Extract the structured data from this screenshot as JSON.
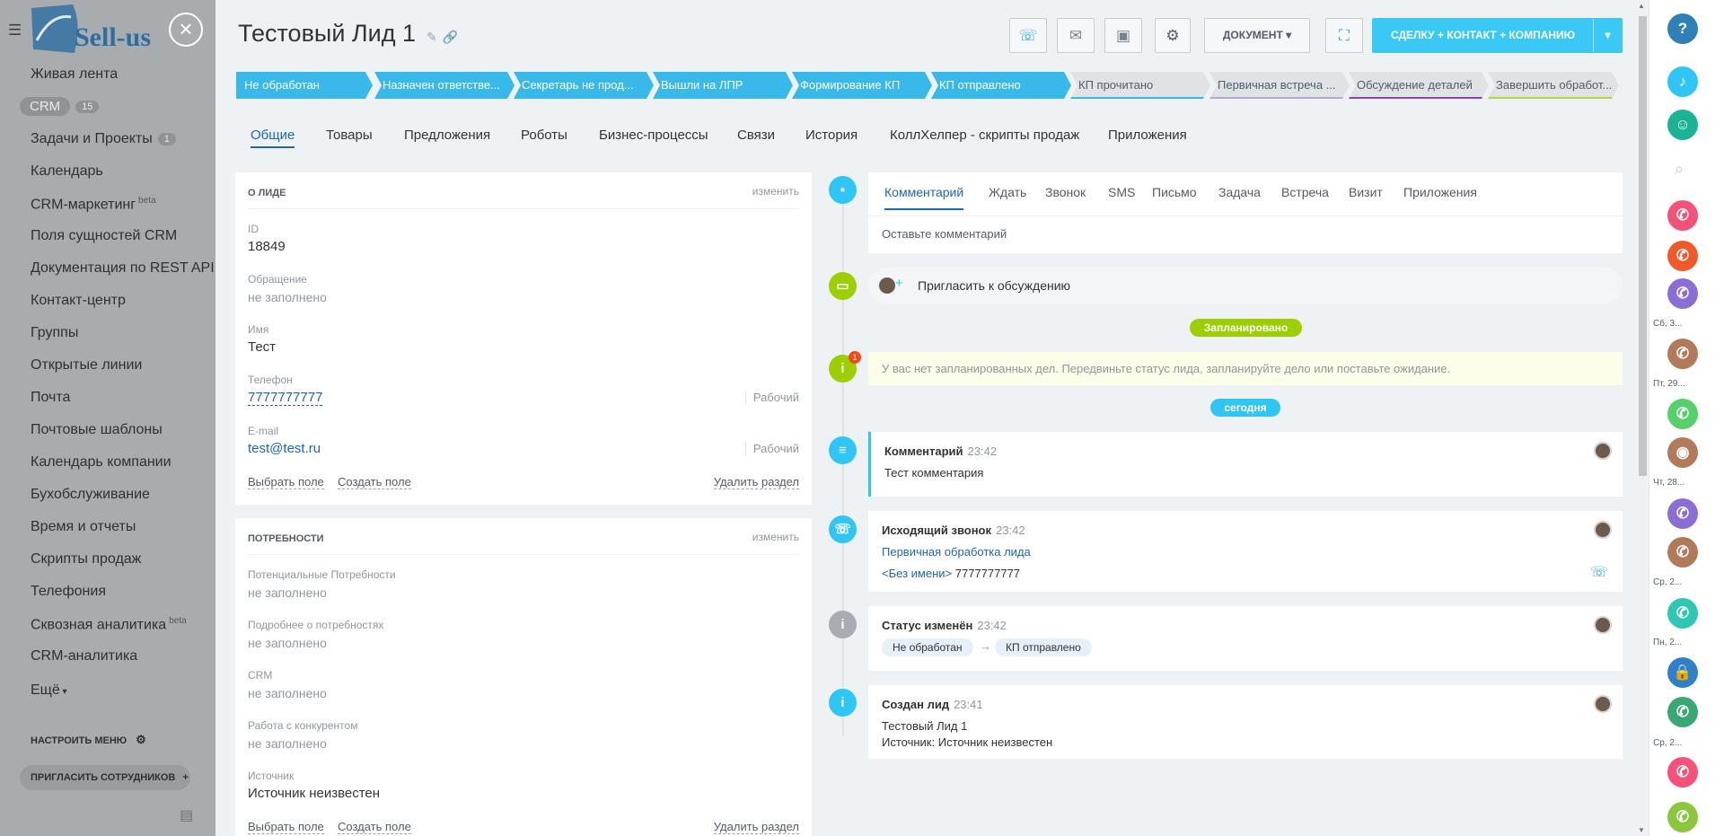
{
  "left_menu": {
    "logo_text": "Sell-us",
    "items": [
      {
        "label": "Живая лента"
      },
      {
        "label": "CRM",
        "badge": "15"
      },
      {
        "label": "Задачи и Проекты",
        "badge": "1"
      },
      {
        "label": "Календарь"
      },
      {
        "label": "CRM-маркетинг",
        "sup": "beta"
      },
      {
        "label": "Поля сущностей CRM"
      },
      {
        "label": "Документация по REST API"
      },
      {
        "label": "Контакт-центр"
      },
      {
        "label": "Группы"
      },
      {
        "label": "Открытые линии"
      },
      {
        "label": "Почта"
      },
      {
        "label": "Почтовые шаблоны"
      },
      {
        "label": "Календарь компании"
      },
      {
        "label": "Бухобслуживание"
      },
      {
        "label": "Время и отчеты"
      },
      {
        "label": "Скрипты продаж"
      },
      {
        "label": "Телефония"
      },
      {
        "label": "Сквозная аналитика",
        "sup": "beta"
      },
      {
        "label": "CRM-аналитика"
      },
      {
        "label": "Ещё"
      }
    ],
    "settings": "НАСТРОИТЬ МЕНЮ",
    "invite": "ПРИГЛАСИТЬ СОТРУДНИКОВ",
    "close_symbol": "×"
  },
  "header": {
    "title": "Тестовый Лид 1",
    "doc_button": "ДОКУМЕНТ",
    "deal_button": "СДЕЛКУ + КОНТАКТ + КОМПАНИЮ"
  },
  "stages": [
    {
      "label": "Не обработан",
      "done": true
    },
    {
      "label": "Назначен ответстве...",
      "done": true
    },
    {
      "label": "Секретарь не прод...",
      "done": true
    },
    {
      "label": "Вышли на ЛПР",
      "done": true
    },
    {
      "label": "Формирование КП",
      "done": true
    },
    {
      "label": "КП отправлено",
      "done": true
    },
    {
      "label": "КП прочитано",
      "done": false,
      "color": "#39b8ea"
    },
    {
      "label": "Первичная встреча ...",
      "done": false,
      "color": "#b3a6d9"
    },
    {
      "label": "Обсуждение деталей",
      "done": false,
      "color": "#8e44ad"
    },
    {
      "label": "Завершить обработ...",
      "done": false,
      "color": "#a8d94a"
    }
  ],
  "tabs": [
    "Общие",
    "Товары",
    "Предложения",
    "Роботы",
    "Бизнес-процессы",
    "Связи",
    "История",
    "КоллХелпер - скрипты продаж",
    "Приложения"
  ],
  "about": {
    "title": "О ЛИДЕ",
    "edit": "изменить",
    "fields": [
      {
        "label": "ID",
        "value": "18849"
      },
      {
        "label": "Обращение",
        "value": "не заполнено"
      },
      {
        "label": "Имя",
        "value": "Тест"
      },
      {
        "label": "Телефон",
        "value": "7777777777",
        "type": "Рабочий"
      },
      {
        "label": "E-mail",
        "value": "test@test.ru",
        "type": "Рабочий"
      }
    ],
    "select_field": "Выбрать поле",
    "create_field": "Создать поле",
    "delete_section": "Удалить раздел"
  },
  "needs": {
    "title": "ПОТРЕБНОСТИ",
    "edit": "изменить",
    "fields": [
      {
        "label": "Потенциальные Потребности",
        "value": "не заполнено"
      },
      {
        "label": "Подробнее о потребностях",
        "value": "не заполнено"
      },
      {
        "label": "CRM",
        "value": "не заполнено"
      },
      {
        "label": "Работа с конкурентом",
        "value": "не заполнено"
      },
      {
        "label": "Источник",
        "value": "Источник неизвестен"
      }
    ],
    "select_field": "Выбрать поле",
    "create_field": "Создать поле",
    "delete_section": "Удалить раздел"
  },
  "timeline": {
    "composer_tabs": [
      "Комментарий",
      "Ждать",
      "Звонок",
      "SMS",
      "Письмо",
      "Задача",
      "Встреча",
      "Визит",
      "Приложения"
    ],
    "composer_placeholder": "Оставьте комментарий",
    "invite": "Пригласить к обсуждению",
    "planned_label": "Запланировано",
    "planned_notice": "У вас нет запланированных дел. Передвиньте статус лида, запланируйте дело или поставьте ожидание.",
    "notice_badge": "1",
    "today_label": "сегодня",
    "events": [
      {
        "title": "Комментарий",
        "time": "23:42",
        "text": "Тест комментария"
      },
      {
        "title": "Исходящий звонок",
        "time": "23:42",
        "link": "Первичная обработка лида",
        "line2_name": "<Без имени>",
        "line2_phone": "7777777777"
      },
      {
        "title": "Статус изменён",
        "time": "23:42",
        "from": "Не обработан",
        "to": "КП отправлено",
        "arrow": "→"
      },
      {
        "title": "Создан лид",
        "time": "23:41",
        "line1": "Тестовый Лид 1",
        "line2": "Источник: Источник неизвестен"
      }
    ]
  },
  "right_panel": {
    "help": "?",
    "labels": [
      "Сб, 3...",
      "Пт, 29...",
      "Чт, 28...",
      "Ср, 2...",
      "Пн, 2...",
      "Ср, 2..."
    ],
    "colors": [
      "#f5527a",
      "#f05a2a",
      "#8a6ed6",
      "#b07a5b",
      "#55d06a",
      "#b07a5b",
      "#8a6ed6",
      "#b07a5b",
      "#2fc6b3",
      "#2f80c8",
      "#3aa874",
      "#f5527a",
      "#8cc63f"
    ]
  }
}
